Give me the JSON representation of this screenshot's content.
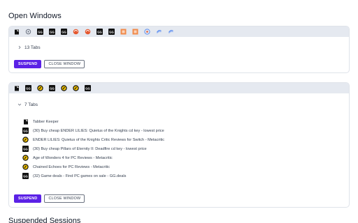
{
  "page": {
    "title": "Open Windows",
    "suspended_title": "Suspended Sessions"
  },
  "windows": [
    {
      "tabs_count_label": "13 Tabs",
      "expanded": false,
      "favicons": [
        "tabber-icon",
        "settings-icon",
        "gg-icon",
        "gg-icon",
        "gg-icon",
        "red-swirl-icon",
        "red-swirl-icon",
        "gg-icon",
        "gg-icon",
        "orange-square-icon",
        "orange-square-icon",
        "blue-globe-icon",
        "blue-swirl-icon",
        "blue-swirl-icon"
      ],
      "suspend_label": "SUSPEND",
      "close_label": "CLOSE WINDOW"
    },
    {
      "tabs_count_label": "7 Tabs",
      "expanded": true,
      "favicons": [
        "tabber-icon",
        "gg-icon",
        "metacritic-icon",
        "gg-icon",
        "metacritic-icon",
        "metacritic-icon",
        "gg-icon"
      ],
      "tabs": [
        {
          "icon": "tabber-icon",
          "title": "Tabber Keeper"
        },
        {
          "icon": "gg-icon",
          "title": "(30) Buy cheap ENDER LILIES: Quietus of the Knights cd key - lowest price"
        },
        {
          "icon": "metacritic-icon",
          "title": "ENDER LILIES: Quietus of the Knights Critic Reviews for Switch - Metacritic"
        },
        {
          "icon": "gg-icon",
          "title": "(30) Buy cheap Pillars of Eternity II: Deadfire cd key - lowest price"
        },
        {
          "icon": "metacritic-icon",
          "title": "Age of Wonders 4 for PC Reviews - Metacritic"
        },
        {
          "icon": "metacritic-icon",
          "title": "Chained Echoes for PC Reviews - Metacritic"
        },
        {
          "icon": "gg-icon",
          "title": "(32) Game deals - Find PC games on sale - GG.deals"
        }
      ],
      "suspend_label": "SUSPEND",
      "close_label": "CLOSE WINDOW"
    }
  ],
  "colors": {
    "accent": "#5b21e6",
    "strip_bg": "#e5e9f0",
    "border": "#dfe3ea"
  }
}
